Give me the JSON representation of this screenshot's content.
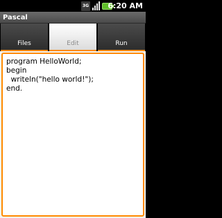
{
  "status_bar": {
    "network_label": "3G",
    "time": "6:20 AM",
    "icons": [
      "network-3g-icon",
      "signal-strength-icon",
      "battery-charging-icon"
    ]
  },
  "app": {
    "title": "Pascal"
  },
  "tabs": [
    {
      "label": "Files",
      "selected": false
    },
    {
      "label": "Edit",
      "selected": true
    },
    {
      "label": "Run",
      "selected": false
    }
  ],
  "editor": {
    "lines": [
      "program HelloWorld;",
      "begin",
      "  writeln(\"hello world!\");",
      "end."
    ]
  },
  "colors": {
    "accent": "#ff8a00",
    "battery": "#5fbf2a"
  }
}
